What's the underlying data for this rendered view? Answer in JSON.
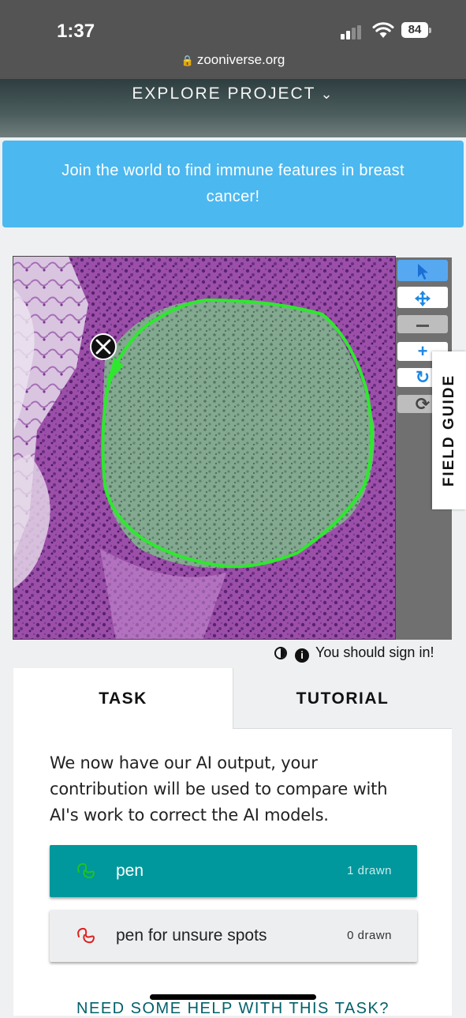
{
  "status_bar": {
    "time": "1:37",
    "battery": "84",
    "url": "zooniverse.org"
  },
  "header": {
    "explore_label": "EXPLORE PROJECT"
  },
  "announcement": {
    "text": "Join the world to find immune features in breast cancer!"
  },
  "viewer": {
    "outline_color": "#2ee82e",
    "tools": [
      {
        "name": "pointer",
        "icon": "pointer-icon",
        "active": true
      },
      {
        "name": "move",
        "icon": "move-icon"
      },
      {
        "name": "zoom-out",
        "icon": "minus-icon"
      },
      {
        "name": "zoom-in",
        "icon": "plus-icon"
      },
      {
        "name": "rotate",
        "icon": "rotate-icon"
      },
      {
        "name": "reset",
        "icon": "reset-icon"
      }
    ],
    "field_guide_label": "FIELD GUIDE"
  },
  "meta": {
    "sign_in_text": "You should sign in!"
  },
  "task_panel": {
    "tabs": [
      "TASK",
      "TUTORIAL"
    ],
    "instruction": "We now have our AI output, your contribution will be used to compare with AI's work to correct the AI models.",
    "tools": [
      {
        "label": "pen",
        "count": "1 drawn",
        "color": "#1fc41f",
        "selected": true
      },
      {
        "label": "pen for unsure spots",
        "count": "0 drawn",
        "color": "#e02020",
        "selected": false
      }
    ],
    "help_text": "NEED SOME HELP WITH THIS TASK?"
  }
}
